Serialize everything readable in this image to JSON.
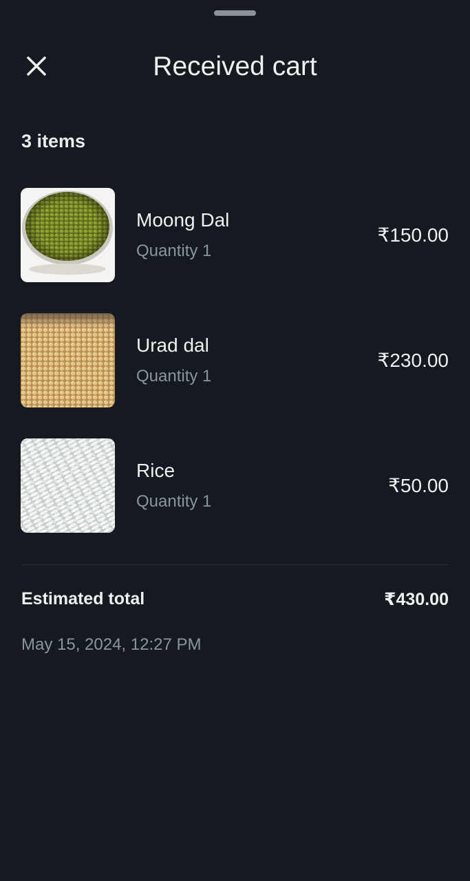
{
  "header": {
    "title": "Received cart",
    "close_icon": "close-icon"
  },
  "cart": {
    "count_label": "3 items",
    "items": [
      {
        "name": "Moong Dal",
        "quantity": "Quantity 1",
        "price": "₹150.00",
        "image": "moong-dal-photo"
      },
      {
        "name": "Urad dal",
        "quantity": "Quantity 1",
        "price": "₹230.00",
        "image": "urad-dal-photo"
      },
      {
        "name": "Rice",
        "quantity": "Quantity 1",
        "price": "₹50.00",
        "image": "rice-photo"
      }
    ],
    "total_label": "Estimated total",
    "total_value": "₹430.00",
    "timestamp": "May 15, 2024, 12:27 PM"
  },
  "colors": {
    "background": "#141a20",
    "primary_text": "#eef1f2",
    "secondary_text": "#8b959d"
  }
}
